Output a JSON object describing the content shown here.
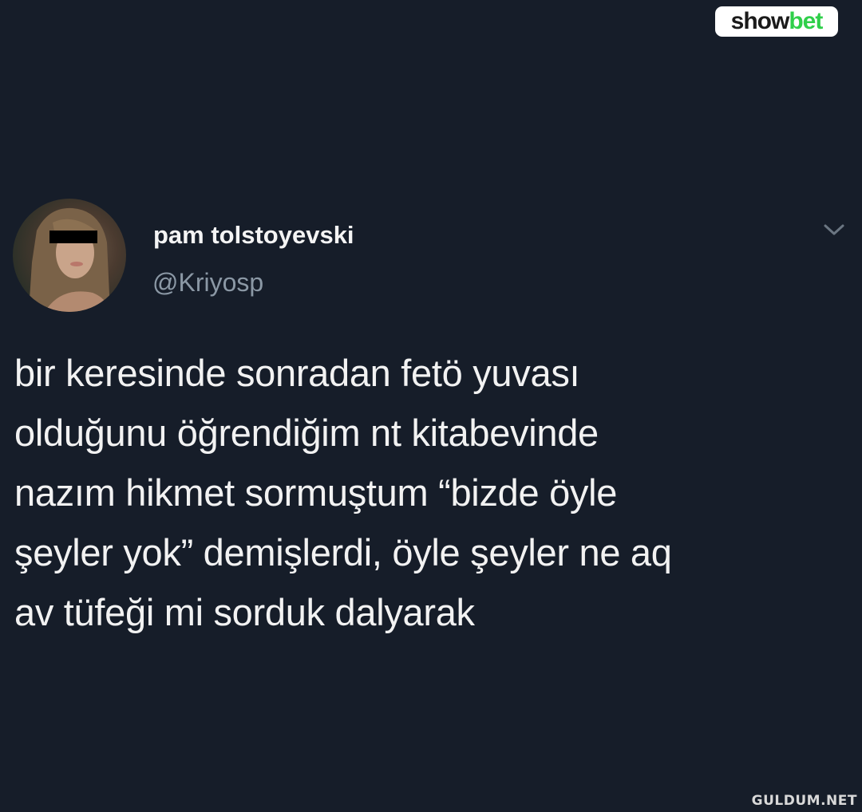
{
  "watermarks": {
    "top_logo": {
      "part1": "show",
      "part2": "bet"
    },
    "bottom": "GULDUM.NET"
  },
  "tweet": {
    "author": {
      "display_name": "pam tolstoyevski",
      "handle": "@Kriyosp",
      "avatar_icon": "profile-photo"
    },
    "menu_icon": "chevron-down-icon",
    "text": "bir keresinde sonradan fetö yuvası\nolduğunu öğrendiğim nt kitabevinde\nnazım hikmet sormuştum “bizde öyle\nşeyler yok” demişlerdi, öyle şeyler ne aq\nav tüfeği mi sorduk dalyarak"
  },
  "colors": {
    "background": "#161d29",
    "text": "#f2f2f2",
    "handle": "#8b98a5",
    "brand_green": "#2fcf4a"
  }
}
